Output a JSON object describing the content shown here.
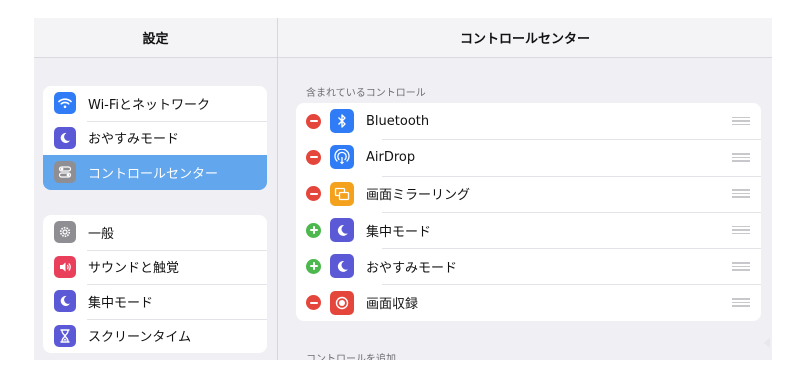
{
  "sidebar": {
    "title": "設定",
    "group1": [
      {
        "label": "Wi-Fiとネットワーク",
        "icon": "wifi-icon",
        "color": "#2f7cf6"
      },
      {
        "label": "おやすみモード",
        "icon": "moon-icon",
        "color": "#5b59d6"
      },
      {
        "label": "コントロールセンター",
        "icon": "toggles-icon",
        "color": "#8e8e93",
        "selected": true
      }
    ],
    "group2": [
      {
        "label": "一般",
        "icon": "gear-icon",
        "color": "#8e8e93"
      },
      {
        "label": "サウンドと触覚",
        "icon": "speaker-icon",
        "color": "#ea3f5a"
      },
      {
        "label": "集中モード",
        "icon": "moon-icon",
        "color": "#5b59d6"
      },
      {
        "label": "スクリーンタイム",
        "icon": "hourglass-icon",
        "color": "#5b59d6"
      }
    ]
  },
  "main": {
    "title": "コントロールセンター",
    "included_title": "含まれているコントロール",
    "more_title": "コントロールを追加",
    "controls": [
      {
        "label": "Bluetooth",
        "action": "remove",
        "icon": "bluetooth-icon",
        "color": "#2f7cf6"
      },
      {
        "label": "AirDrop",
        "action": "remove",
        "icon": "airdrop-icon",
        "color": "#2f7cf6"
      },
      {
        "label": "画面ミラーリング",
        "action": "remove",
        "icon": "screen-mirroring-icon",
        "color": "#f4a11e"
      },
      {
        "label": "集中モード",
        "action": "add",
        "icon": "moon-icon",
        "color": "#5b59d6"
      },
      {
        "label": "おやすみモード",
        "action": "add",
        "icon": "moon-icon",
        "color": "#5b59d6"
      },
      {
        "label": "画面収録",
        "action": "remove",
        "icon": "screen-recording-icon",
        "color": "#e5463b"
      }
    ]
  }
}
